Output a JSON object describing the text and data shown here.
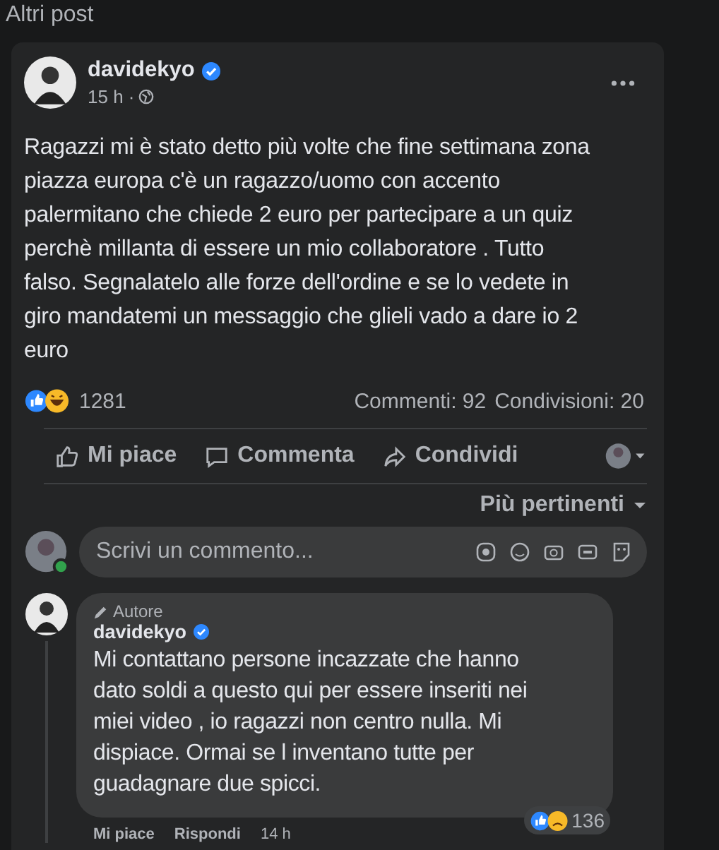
{
  "section_title": "Altri post",
  "post": {
    "author": "davidekyo",
    "verified": true,
    "time": "15 h ·",
    "text": "Ragazzi mi è stato detto più volte che fine settimana zona piazza europa c'è un ragazzo/uomo con accento palermitano che chiede 2 euro per partecipare a un quiz perchè millanta di essere un mio collaboratore . Tutto falso. Segnalatelo alle forze dell'ordine e se lo vedete in giro mandatemi un messaggio  che glieli vado a dare io 2 euro",
    "reactions_count": "1281",
    "comments": "Commenti: 92",
    "shares": "Condivisioni: 20"
  },
  "actions": [
    {
      "kind": "like",
      "label": "Mi piace"
    },
    {
      "kind": "comment",
      "label": "Commenta"
    },
    {
      "kind": "share",
      "label": "Condividi"
    }
  ],
  "sort": "Più pertinenti",
  "composer": {
    "placeholder": "Scrivi un commento..."
  },
  "comment": {
    "badge": "Autore",
    "author": "davidekyo",
    "verified": true,
    "text": "Mi contattano persone incazzate che hanno dato soldi a questo qui per essere inseriti nei miei video , io ragazzi non centro nulla. Mi dispiace. Ormai se l inventano tutte per guadagnare due spicci.",
    "reactions_count": "136",
    "like": "Mi piace",
    "reply": "Rispondi",
    "time": "14 h"
  }
}
